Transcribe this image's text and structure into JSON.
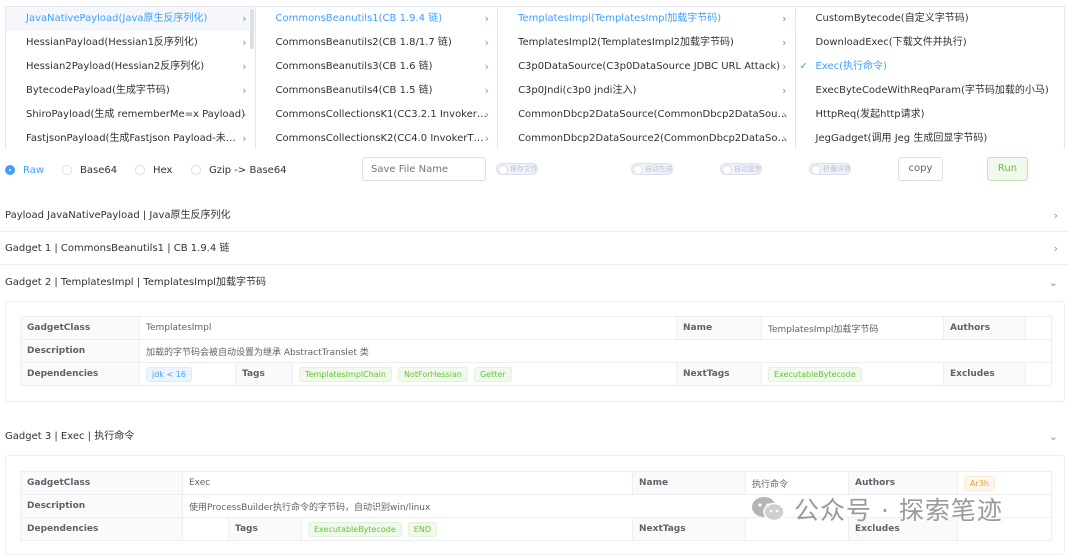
{
  "cascader": {
    "col1": [
      {
        "label": "JavaNativePayload(Java原生反序列化)",
        "active": true
      },
      {
        "label": "HessianPayload(Hessian1反序列化)"
      },
      {
        "label": "Hessian2Payload(Hessian2反序列化)"
      },
      {
        "label": "BytecodePayload(生成字节码)"
      },
      {
        "label": "ShiroPayload(生成 rememberMe=x Payload)"
      },
      {
        "label": "FastjsonPayload(生成Fastjson Payload-未…"
      }
    ],
    "col2": [
      {
        "label": "CommonsBeanutils1(CB 1.9.4 链)",
        "active": true
      },
      {
        "label": "CommonsBeanutils2(CB 1.8/1.7 链)"
      },
      {
        "label": "CommonsBeanutils3(CB 1.6 链)"
      },
      {
        "label": "CommonsBeanutils4(CB 1.5 链)"
      },
      {
        "label": "CommonsCollectionsK1(CC3.2.1 Invoker…"
      },
      {
        "label": "CommonsCollectionsK2(CC4.0 InvokerT…"
      }
    ],
    "col3": [
      {
        "label": "TemplatesImpl(TemplatesImpl加载字节码)",
        "active": true
      },
      {
        "label": "TemplatesImpl2(TemplatesImpl2加载字节码)"
      },
      {
        "label": "C3p0DataSource(C3p0DataSource JDBC URL Attack)"
      },
      {
        "label": "C3p0Jndi(c3p0 jndi注入)"
      },
      {
        "label": "CommonDbcp2DataSource(CommonDbcp2DataSou…"
      },
      {
        "label": "CommonDbcp2DataSource2(CommonDbcp2DataSo…"
      }
    ],
    "col4": [
      {
        "label": "CustomBytecode(自定义字节码)"
      },
      {
        "label": "DownloadExec(下载文件并执行)"
      },
      {
        "label": "Exec(执行命令)",
        "active": true
      },
      {
        "label": "ExecByteCodeWithReqParam(字节码加载的小马)"
      },
      {
        "label": "HttpReq(发起http请求)"
      },
      {
        "label": "JegGadget(调用 Jeg 生成回显字节码)"
      }
    ]
  },
  "options": {
    "radios": [
      {
        "label": "Raw",
        "checked": true
      },
      {
        "label": "Base64"
      },
      {
        "label": "Hex"
      },
      {
        "label": "Gzip -> Base64"
      }
    ],
    "file_placeholder": "Save File Name",
    "switches": [
      "保存文件",
      "自动生成",
      "自动复制",
      "折叠详情"
    ],
    "copy_label": "copy",
    "run_label": "Run"
  },
  "sections": {
    "payload": "Payload JavaNativePayload | Java原生反序列化",
    "gadget1": "Gadget 1 | CommonsBeanutils1 | CB 1.9.4 链",
    "gadget2": "Gadget 2 | TemplatesImpl | TemplatesImpl加载字节码",
    "gadget3": "Gadget 3 | Exec | 执行命令"
  },
  "labels": {
    "gadget_class": "GadgetClass",
    "name": "Name",
    "authors": "Authors",
    "description": "Description",
    "dependencies": "Dependencies",
    "tags": "Tags",
    "next_tags": "NextTags",
    "excludes": "Excludes"
  },
  "g2": {
    "class": "TemplatesImpl",
    "name": "TemplatesImpl加载字节码",
    "description": "加载的字节码会被自动设置为继承 AbstractTranslet 类",
    "dependency": "jdk < 16",
    "tags": [
      "TemplatesImplChain",
      "NotForHessian",
      "Getter"
    ],
    "next_tag": "ExecutableBytecode"
  },
  "g3": {
    "class": "Exec",
    "name": "执行命令",
    "author": "Ar3h",
    "description": "使用ProcessBuilder执行命令的字节码，自动识别win/linux",
    "tags": [
      "ExecutableBytecode",
      "END"
    ]
  },
  "watermark": "公众号 · 探索笔迹",
  "colors": {
    "accent": "#409eff",
    "success": "#67c23a",
    "warning": "#e6a23c"
  }
}
